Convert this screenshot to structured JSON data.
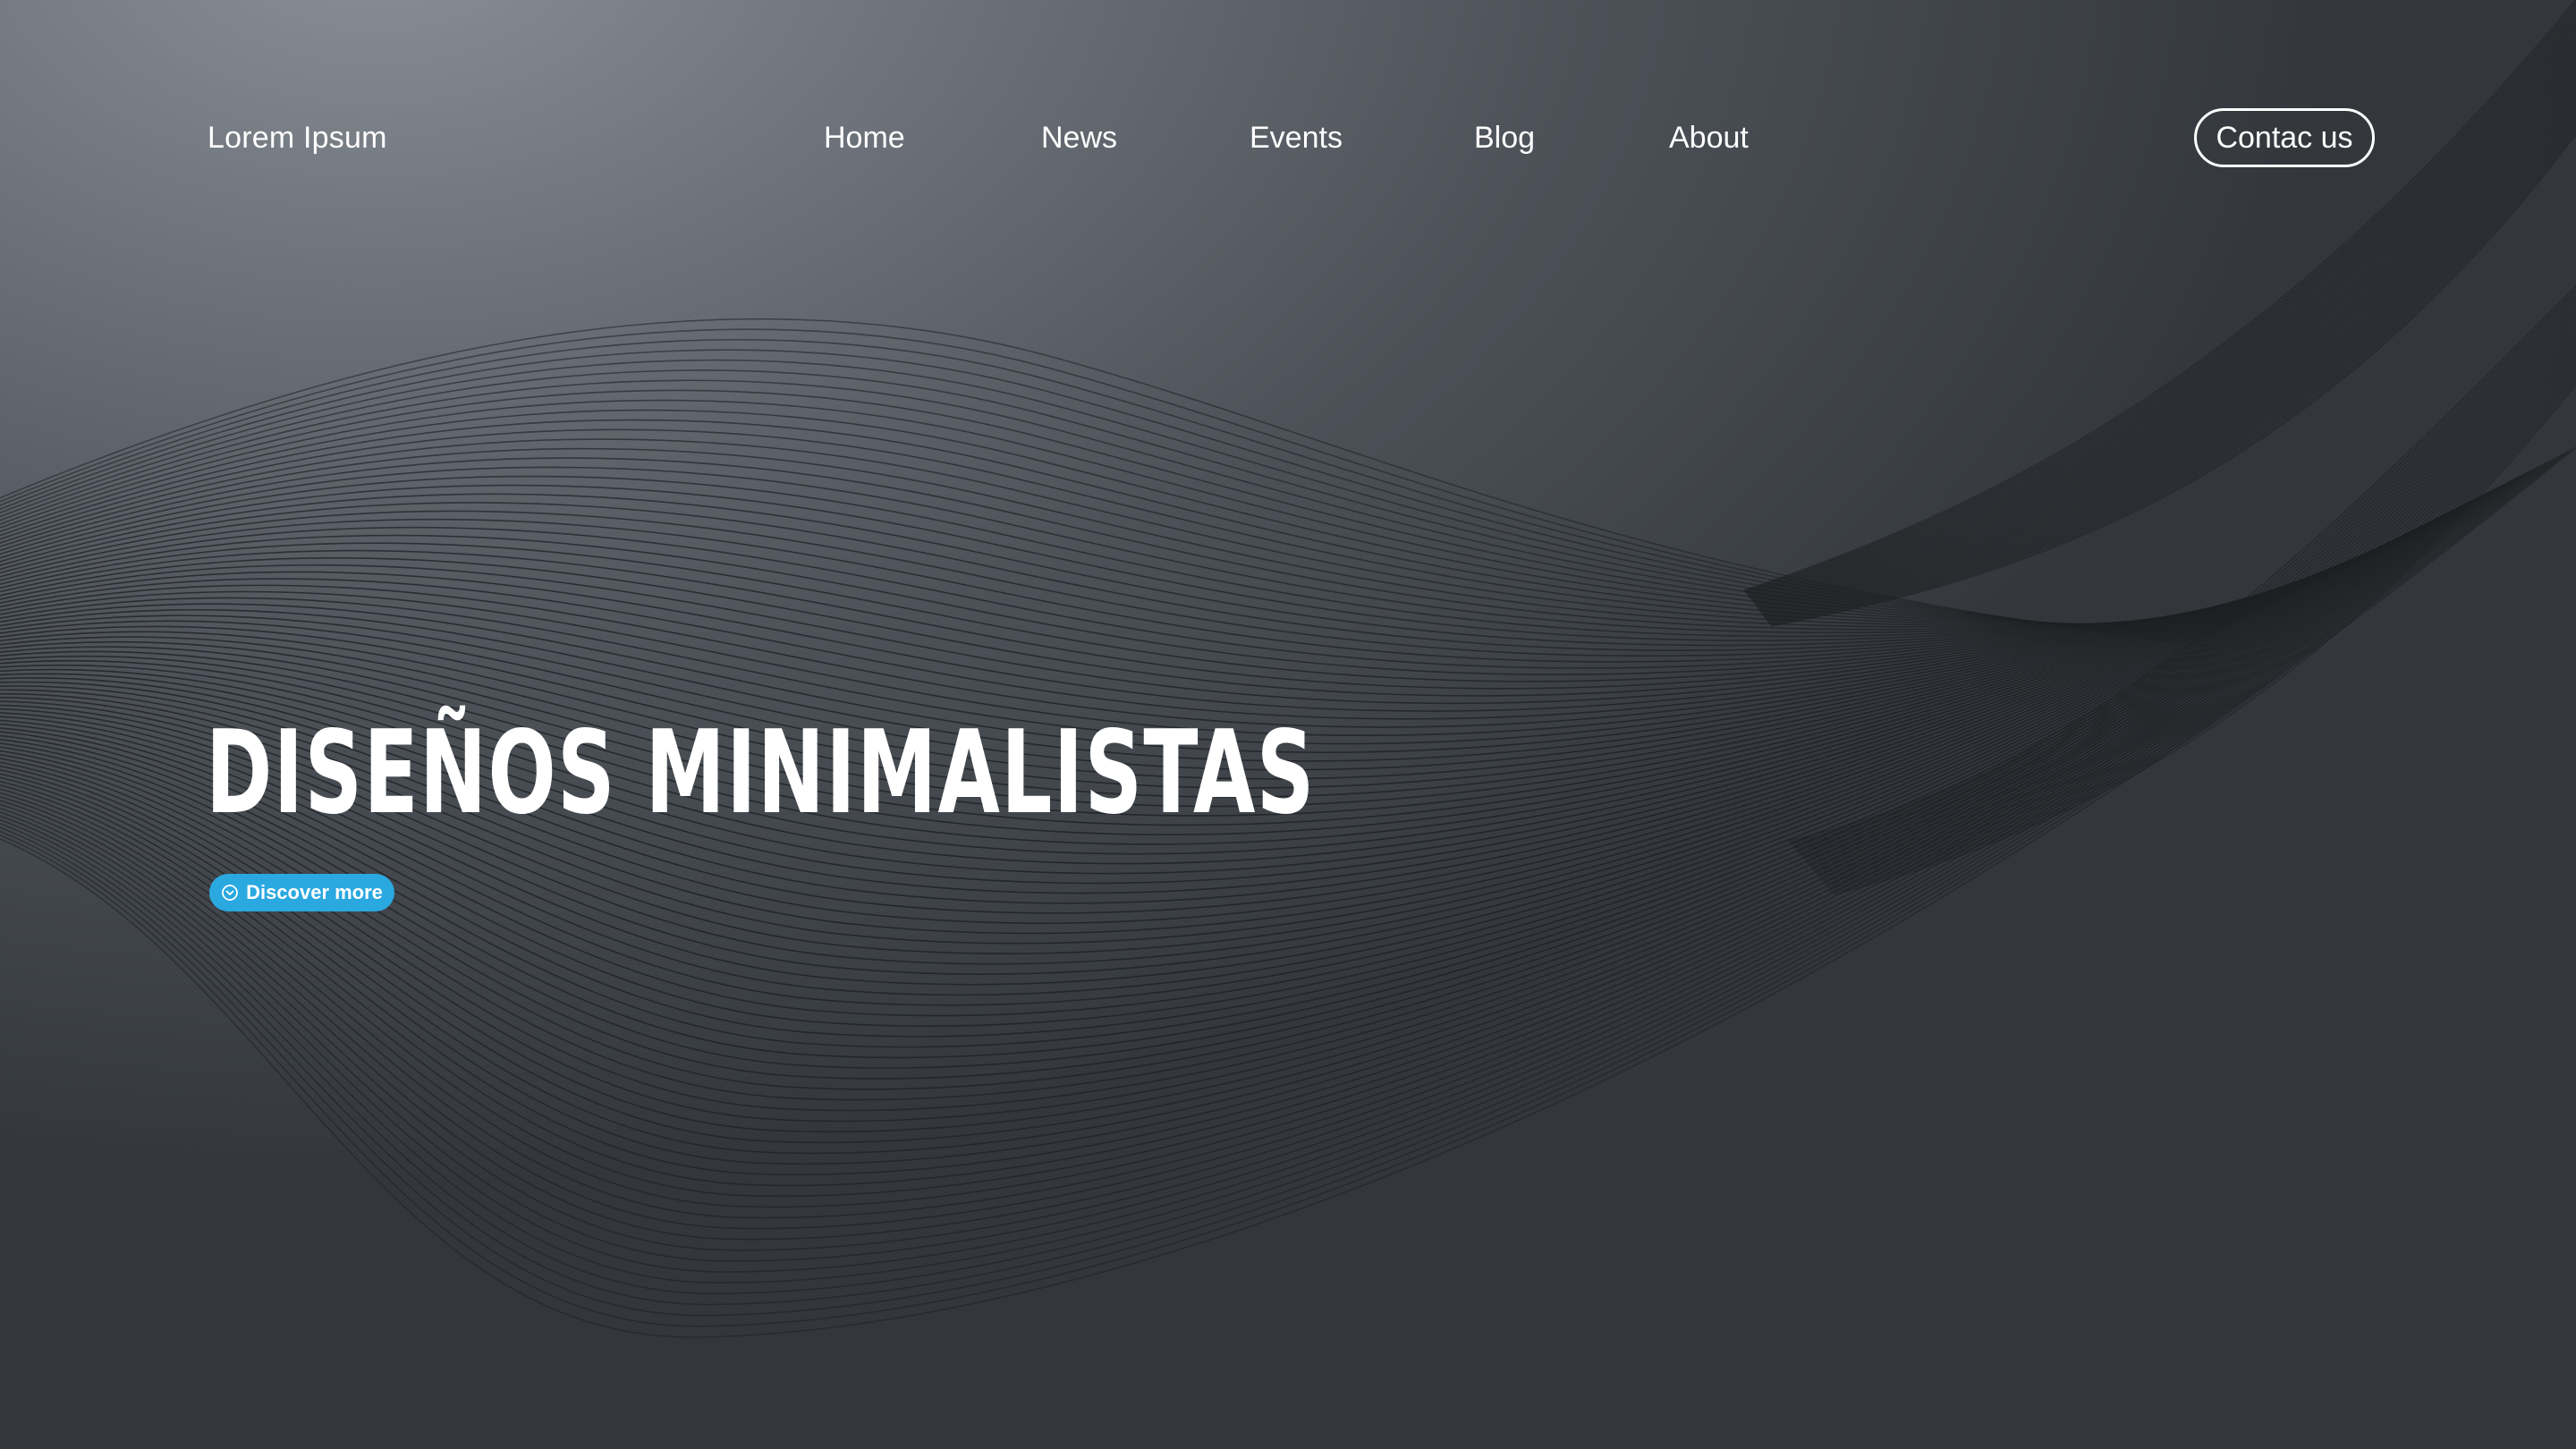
{
  "header": {
    "brand": "Lorem Ipsum",
    "nav": [
      {
        "id": "home",
        "label": "Home"
      },
      {
        "id": "news",
        "label": "News"
      },
      {
        "id": "events",
        "label": "Events"
      },
      {
        "id": "blog",
        "label": "Blog"
      },
      {
        "id": "about",
        "label": "About"
      }
    ],
    "contact_label": "Contac us"
  },
  "hero": {
    "title": "DISEÑOS MINIMALISTAS",
    "cta_label": "Discover more",
    "cta_icon": "chevron-down-circle-icon"
  },
  "colors": {
    "accent": "#2aa8e0",
    "text": "#ffffff",
    "wave_lines": "#1e2022"
  }
}
